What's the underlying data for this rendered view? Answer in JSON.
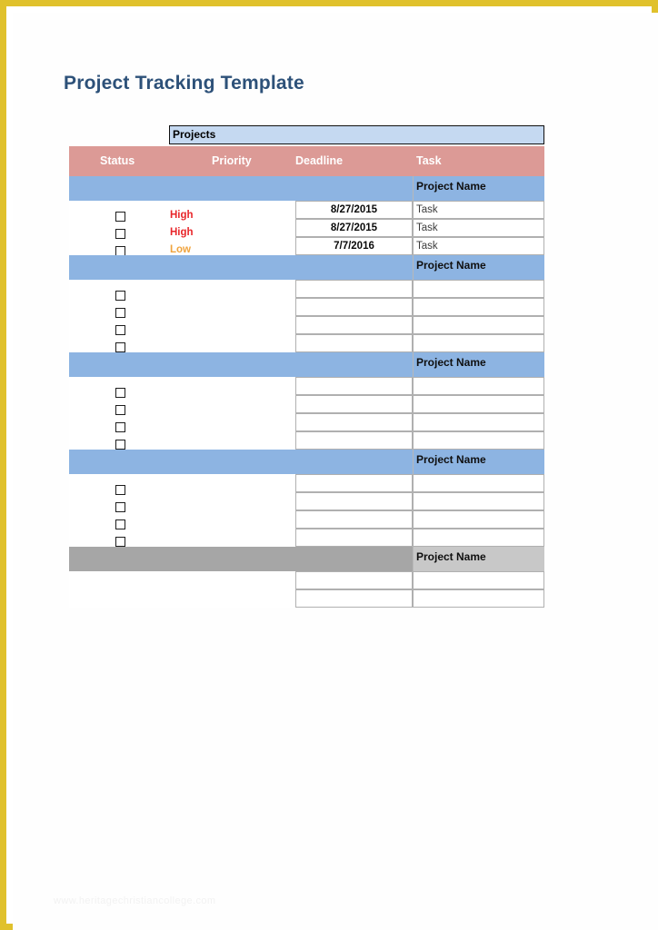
{
  "document": {
    "title": "Project Tracking Template",
    "watermark": "www.heritagechristiancollege.com",
    "border_color": "#e0c12c"
  },
  "table": {
    "section_bar_label": "Projects",
    "columns": [
      {
        "key": "status",
        "label": "Status"
      },
      {
        "key": "priority",
        "label": "Priority"
      },
      {
        "key": "deadline",
        "label": "Deadline"
      },
      {
        "key": "task",
        "label": "Task"
      }
    ],
    "colors": {
      "header_pink": "#dc9a96",
      "band_blue": "#8db4e2",
      "band_gray": "#a6a6a6",
      "band_gray_name": "#c8c8c8",
      "projects_bar_blue": "#c5d9f1",
      "priority_high": "#e8262a",
      "priority_low": "#f0a33c",
      "title_blue": "#2d5179"
    },
    "blocks": [
      {
        "band_style": "blue",
        "project_name": "Project Name",
        "rows": [
          {
            "checkbox": false,
            "priority": "",
            "deadline": "8/27/2015",
            "task": "Task"
          },
          {
            "checkbox": true,
            "priority": "High",
            "priority_level": "high",
            "deadline": "8/27/2015",
            "task": "Task"
          },
          {
            "checkbox": true,
            "priority": "High",
            "priority_level": "high",
            "deadline": "7/7/2016",
            "task": "Task"
          },
          {
            "checkbox": true,
            "priority": "Low",
            "priority_level": "low",
            "deadline": "",
            "task": ""
          }
        ],
        "checkbox_count": 3,
        "priorities": [
          {
            "label": "High",
            "level": "high"
          },
          {
            "label": "High",
            "level": "high"
          },
          {
            "label": "Low",
            "level": "low"
          }
        ],
        "deadlines": [
          "8/27/2015",
          "8/27/2015",
          "7/7/2016"
        ],
        "tasks": [
          "Task",
          "Task",
          "Task"
        ]
      },
      {
        "band_style": "blue",
        "project_name": "Project Name",
        "checkbox_count": 4,
        "priorities": [],
        "deadlines": [
          "",
          "",
          "",
          ""
        ],
        "tasks": [
          "",
          "",
          "",
          ""
        ]
      },
      {
        "band_style": "blue",
        "project_name": "Project Name",
        "checkbox_count": 4,
        "priorities": [],
        "deadlines": [
          "",
          "",
          "",
          ""
        ],
        "tasks": [
          "",
          "",
          "",
          ""
        ]
      },
      {
        "band_style": "blue",
        "project_name": "Project Name",
        "checkbox_count": 4,
        "priorities": [],
        "deadlines": [
          "",
          "",
          "",
          ""
        ],
        "tasks": [
          "",
          "",
          "",
          ""
        ]
      },
      {
        "band_style": "gray",
        "project_name": "Project Name",
        "checkbox_count": 0,
        "priorities": [],
        "deadlines": [
          "",
          ""
        ],
        "tasks": [
          "",
          ""
        ]
      }
    ]
  }
}
